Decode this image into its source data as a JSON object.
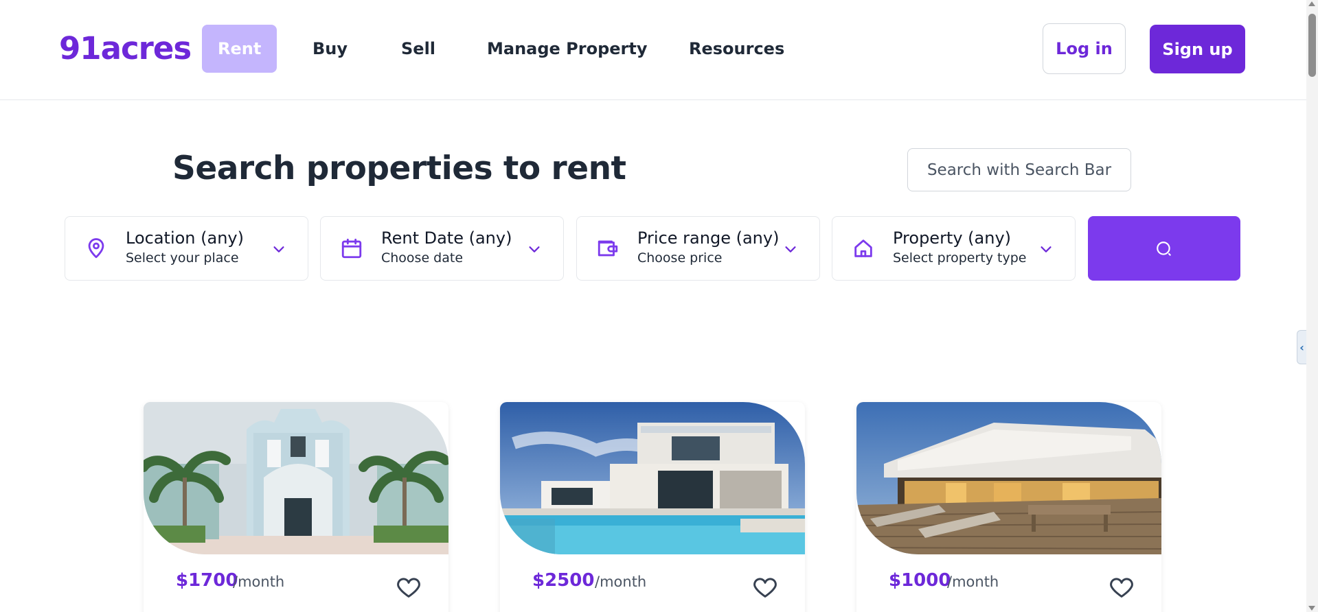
{
  "nav": {
    "logo": "91acres",
    "links": [
      "Rent",
      "Buy",
      "Sell",
      "Manage Property",
      "Resources"
    ],
    "login_label": "Log in",
    "signup_label": "Sign up"
  },
  "search": {
    "heading": "Search properties to rent",
    "search_bar_button": "Search with Search Bar",
    "filters": [
      {
        "title": "Location (any)",
        "subtitle": "Select your place",
        "icon": "location-pin-icon"
      },
      {
        "title": "Rent Date (any)",
        "subtitle": "Choose date",
        "icon": "calendar-icon"
      },
      {
        "title": "Price range (any)",
        "subtitle": "Choose price",
        "icon": "wallet-icon"
      },
      {
        "title": "Property (any)",
        "subtitle": "Select property type",
        "icon": "home-icon"
      }
    ],
    "submit_icon": "search-icon"
  },
  "listings": [
    {
      "price": "$1700",
      "period": "/month",
      "image": "white-colonial-house-with-palms"
    },
    {
      "price": "$2500",
      "period": "/month",
      "image": "modern-villa-with-pool"
    },
    {
      "price": "$1000",
      "period": "/month",
      "image": "deck-with-loungers-at-dusk"
    }
  ],
  "colors": {
    "accent": "#6d28d9",
    "accent_light": "#c4b5fd",
    "search_button": "#7c3aed"
  }
}
